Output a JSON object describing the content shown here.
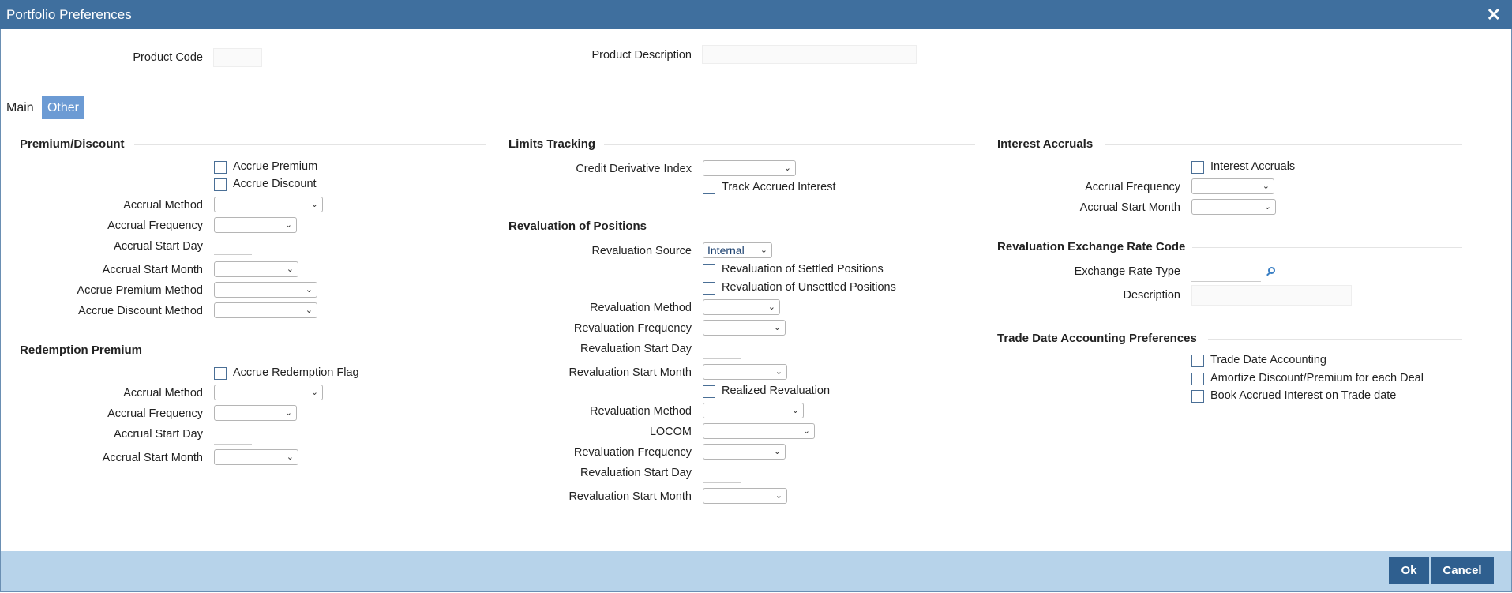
{
  "window": {
    "title": "Portfolio Preferences",
    "close_glyph": "✕"
  },
  "header": {
    "product_code_label": "Product Code",
    "product_description_label": "Product Description"
  },
  "tabs": [
    {
      "label": "Main",
      "active": false
    },
    {
      "label": "Other",
      "active": true
    }
  ],
  "premium_discount": {
    "title": "Premium/Discount",
    "accrue_premium": "Accrue Premium",
    "accrue_discount": "Accrue Discount",
    "accrual_method": "Accrual Method",
    "accrual_frequency": "Accrual Frequency",
    "accrual_start_day": "Accrual Start Day",
    "accrual_start_month": "Accrual Start Month",
    "accrue_premium_method": "Accrue Premium Method",
    "accrue_discount_method": "Accrue Discount Method"
  },
  "redemption_premium": {
    "title": "Redemption Premium",
    "accrue_redemption_flag": "Accrue Redemption Flag",
    "accrual_method": "Accrual Method",
    "accrual_frequency": "Accrual Frequency",
    "accrual_start_day": "Accrual Start Day",
    "accrual_start_month": "Accrual Start Month"
  },
  "limits_tracking": {
    "title": "Limits Tracking",
    "credit_derivative_index": "Credit Derivative Index",
    "track_accrued_interest": "Track Accrued Interest"
  },
  "revaluation": {
    "title": "Revaluation of Positions",
    "revaluation_source": "Revaluation Source",
    "revaluation_source_value": "Internal",
    "settled_positions": "Revaluation of Settled Positions",
    "unsettled_positions": "Revaluation of Unsettled Positions",
    "revaluation_method": "Revaluation Method",
    "revaluation_frequency": "Revaluation Frequency",
    "revaluation_start_day": "Revaluation Start Day",
    "revaluation_start_month": "Revaluation Start Month",
    "realized_revaluation": "Realized Revaluation",
    "revaluation_method_2": "Revaluation Method",
    "locom": "LOCOM",
    "revaluation_frequency_2": "Revaluation Frequency",
    "revaluation_start_day_2": "Revaluation Start Day",
    "revaluation_start_month_2": "Revaluation Start Month"
  },
  "interest_accruals": {
    "title": "Interest Accruals",
    "interest_accruals_cb": "Interest Accruals",
    "accrual_frequency": "Accrual Frequency",
    "accrual_start_month": "Accrual Start Month"
  },
  "exchange_rate": {
    "title": "Revaluation Exchange Rate Code",
    "exchange_rate_type": "Exchange Rate Type",
    "description": "Description"
  },
  "trade_date": {
    "title": "Trade Date Accounting Preferences",
    "trade_date_accounting": "Trade Date Accounting",
    "amortize": "Amortize Discount/Premium for each Deal",
    "book_accrued": "Book Accrued Interest on Trade date"
  },
  "footer": {
    "ok": "Ok",
    "cancel": "Cancel"
  }
}
